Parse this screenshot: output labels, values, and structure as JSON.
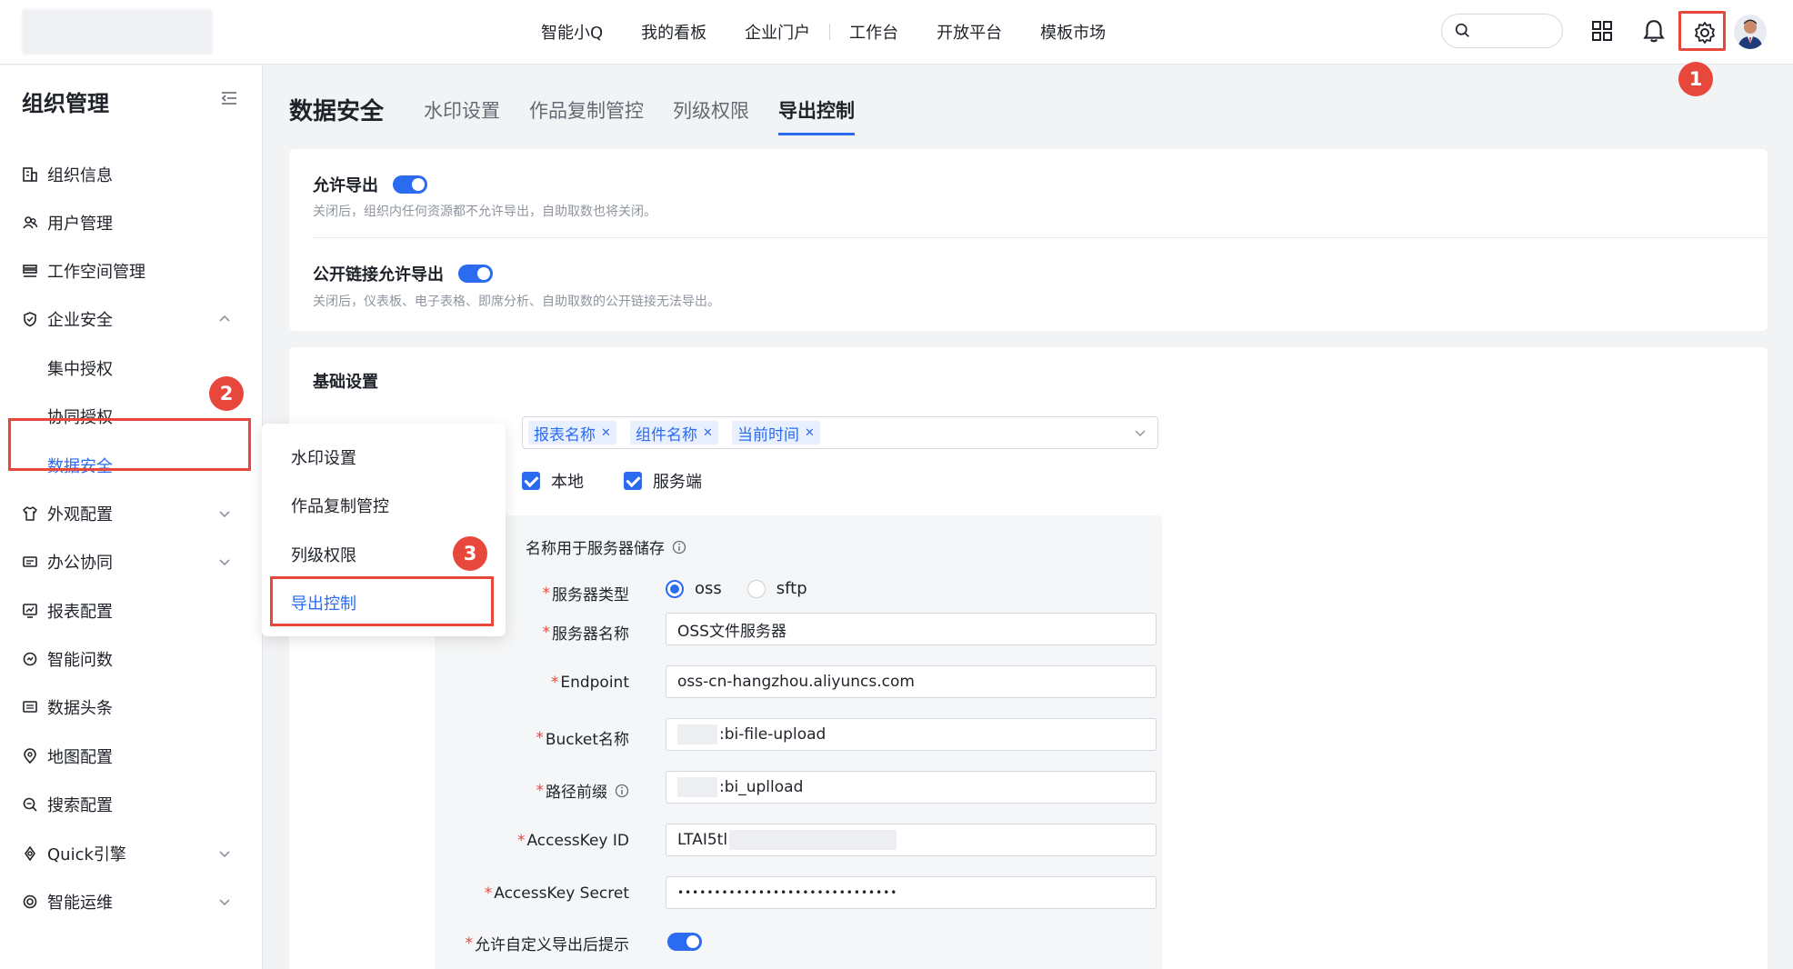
{
  "topnav": {
    "items": [
      "智能小Q",
      "我的看板",
      "企业门户",
      "工作台",
      "开放平台",
      "模板市场"
    ]
  },
  "badges": {
    "one": "1",
    "two": "2",
    "three": "3"
  },
  "sidebar": {
    "title": "组织管理",
    "items": [
      {
        "label": "组织信息",
        "icon": "building-icon"
      },
      {
        "label": "用户管理",
        "icon": "users-icon"
      },
      {
        "label": "工作空间管理",
        "icon": "workspace-icon"
      },
      {
        "label": "企业安全",
        "icon": "shield-icon",
        "expanded": true
      },
      {
        "label": "集中授权",
        "sub": true
      },
      {
        "label": "协同授权",
        "sub": true
      },
      {
        "label": "数据安全",
        "sub": true,
        "active": true
      },
      {
        "label": "外观配置",
        "icon": "shirt-icon"
      },
      {
        "label": "办公协同",
        "icon": "office-icon"
      },
      {
        "label": "报表配置",
        "icon": "report-icon"
      },
      {
        "label": "智能问数",
        "icon": "smart-query-icon"
      },
      {
        "label": "数据头条",
        "icon": "news-icon"
      },
      {
        "label": "地图配置",
        "icon": "map-icon"
      },
      {
        "label": "搜索配置",
        "icon": "search-config-icon"
      },
      {
        "label": "Quick引擎",
        "icon": "engine-icon"
      },
      {
        "label": "智能运维",
        "icon": "ops-icon"
      }
    ]
  },
  "main": {
    "title": "数据安全",
    "tabs": [
      "水印设置",
      "作品复制管控",
      "列级权限",
      "导出控制"
    ],
    "active_tab": "导出控制",
    "allow_export": {
      "label": "允许导出",
      "desc": "关闭后，组织内任何资源都不允许导出，自助取数也将关闭。",
      "on": true
    },
    "public_link_export": {
      "label": "公开链接允许导出",
      "desc": "关闭后，仪表板、电子表格、即席分析、自助取数的公开链接无法导出。",
      "on": true
    },
    "basic": {
      "title": "基础设置",
      "tags": [
        "报表名称",
        "组件名称",
        "当前时间"
      ],
      "checkboxes": [
        "本地",
        "服务端"
      ],
      "server_head": "名称用于服务器储存",
      "fields": {
        "server_type": {
          "label": "服务器类型",
          "options": [
            "oss",
            "sftp"
          ],
          "selected": "oss"
        },
        "server_name": {
          "label": "服务器名称",
          "value": "OSS文件服务器"
        },
        "endpoint": {
          "label": "Endpoint",
          "value": "oss-cn-hangzhou.aliyuncs.com"
        },
        "bucket": {
          "label": "Bucket名称",
          "value": ":bi-file-upload"
        },
        "path_prefix": {
          "label": "路径前缀",
          "value": ":bi_uplload"
        },
        "access_key_id": {
          "label": "AccessKey ID",
          "value": "LTAI5tl"
        },
        "access_key_secret": {
          "label": "AccessKey Secret",
          "value": "••••••••••••••••••••••••••••••"
        },
        "custom_hint": {
          "label": "允许自定义导出后提示",
          "on": true
        }
      }
    }
  },
  "popup": {
    "items": [
      "水印设置",
      "作品复制管控",
      "列级权限",
      "导出控制"
    ],
    "active": "导出控制"
  },
  "colors": {
    "accent": "#2a6bef",
    "highlight": "#e8473c"
  }
}
